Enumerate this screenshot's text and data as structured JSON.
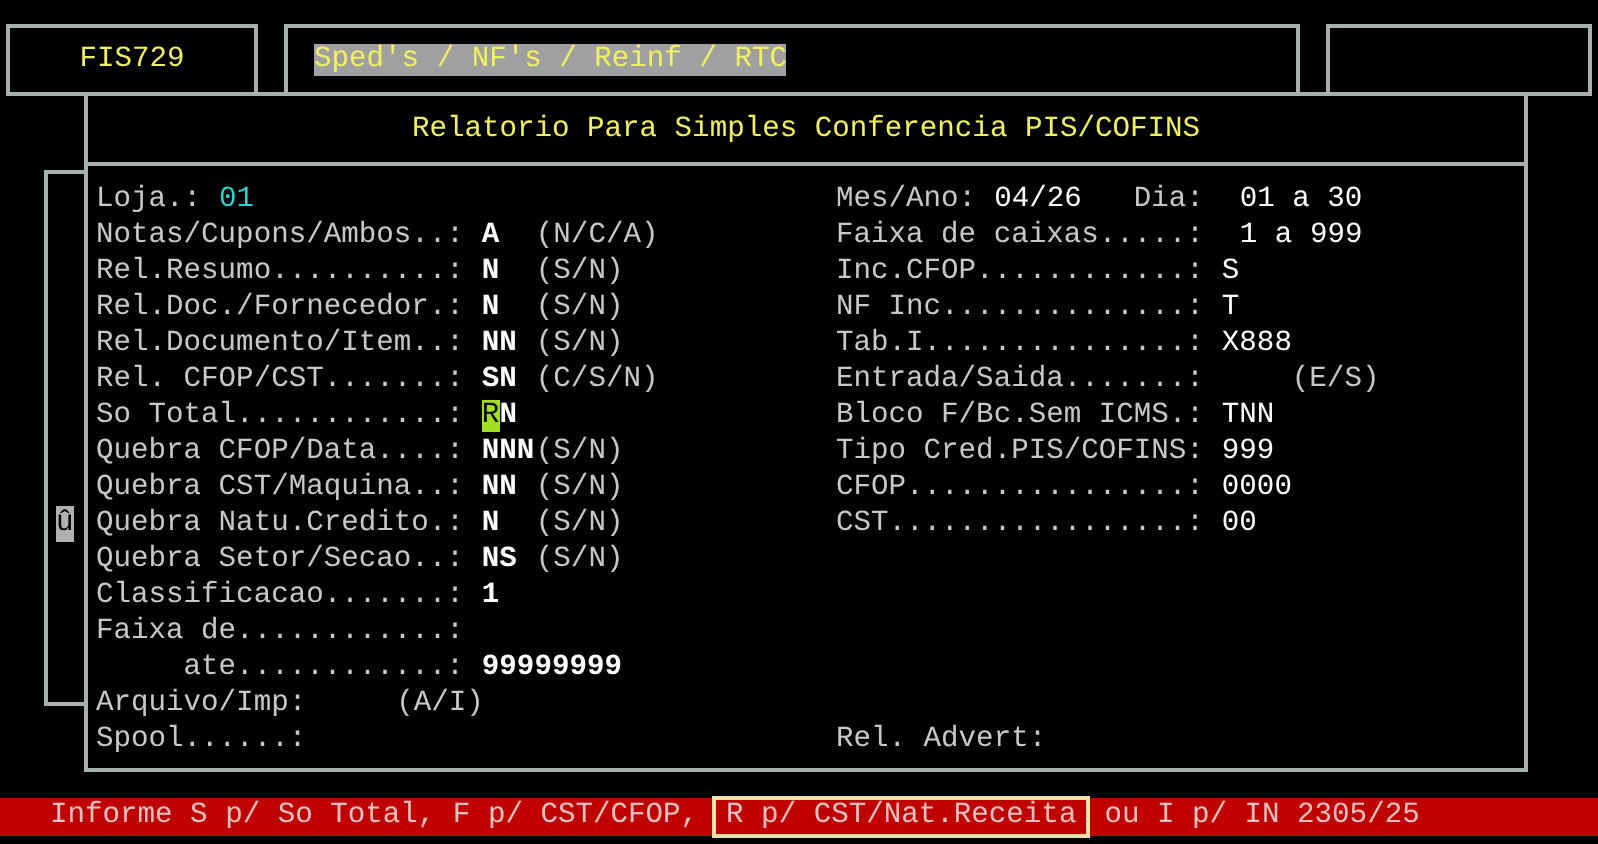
{
  "header": {
    "program_code": "FIS729",
    "menu_path": "Sped's / NF's / Reinf / RTC"
  },
  "dialog": {
    "title": "Relatorio Para Simples Conferencia PIS/COFINS",
    "scroll_marker": "û",
    "loja": {
      "label": "Loja.:",
      "value": "01"
    },
    "left_fields": [
      {
        "label": "Notas/Cupons/Ambos..:",
        "value": "A",
        "hint": "(N/C/A)"
      },
      {
        "label": "Rel.Resumo..........:",
        "value": "N",
        "hint": "(S/N)"
      },
      {
        "label": "Rel.Doc./Fornecedor.:",
        "value": "N",
        "hint": "(S/N)"
      },
      {
        "label": "Rel.Documento/Item..:",
        "value": "NN",
        "hint": "(S/N)"
      },
      {
        "label": "Rel. CFOP/CST.......:",
        "value": "SN",
        "hint": "(C/S/N)"
      },
      {
        "label": "So Total............:",
        "value": "RN",
        "focused": true
      },
      {
        "label": "Quebra CFOP/Data....:",
        "value": "NNN",
        "hint": "(S/N)"
      },
      {
        "label": "Quebra CST/Maquina..:",
        "value": "NN",
        "hint": "(S/N)"
      },
      {
        "label": "Quebra Natu.Credito.:",
        "value": "N",
        "hint": "(S/N)"
      },
      {
        "label": "Quebra Setor/Secao..:",
        "value": "NS",
        "hint": "(S/N)"
      },
      {
        "label": "Classificacao.......:",
        "value": "1"
      },
      {
        "label": "Faixa de............:"
      },
      {
        "label": "     ate............:",
        "value": "99999999"
      },
      {
        "label": "Arquivo/Imp:",
        "hint": "(A/I)"
      },
      {
        "label": "Spool......:"
      }
    ],
    "right_fields": [
      {
        "label": "Mes/Ano:",
        "value": "04/26",
        "extra_label": "Dia:",
        "extra_value": "01 a 30"
      },
      {
        "label": "Faixa de caixas.....:",
        "value": "1 a 999"
      },
      {
        "label": "Inc.CFOP............:",
        "value": "S"
      },
      {
        "label": "NF Inc..............:",
        "value": "T"
      },
      {
        "label": "Tab.I...............:",
        "value": "X888"
      },
      {
        "label": "Entrada/Saida.......:",
        "hint": "(E/S)"
      },
      {
        "label": "Bloco F/Bc.Sem ICMS.:",
        "value": "TNN"
      },
      {
        "label": "Tipo Cred.PIS/COFINS:",
        "value": "999"
      },
      {
        "label": "CFOP................:",
        "value": "0000"
      },
      {
        "label": "CST.................:",
        "value": "00"
      }
    ],
    "advert_label": "Rel. Advert:"
  },
  "status_bar": {
    "segments": [
      {
        "text": "Informe S p/ So Total, F p/ CST/CFOP,",
        "selected": false
      },
      {
        "text": "R p/ CST/Nat.Receita",
        "selected": true
      },
      {
        "text": "ou I p/ IN 2305/25",
        "selected": false
      }
    ]
  }
}
